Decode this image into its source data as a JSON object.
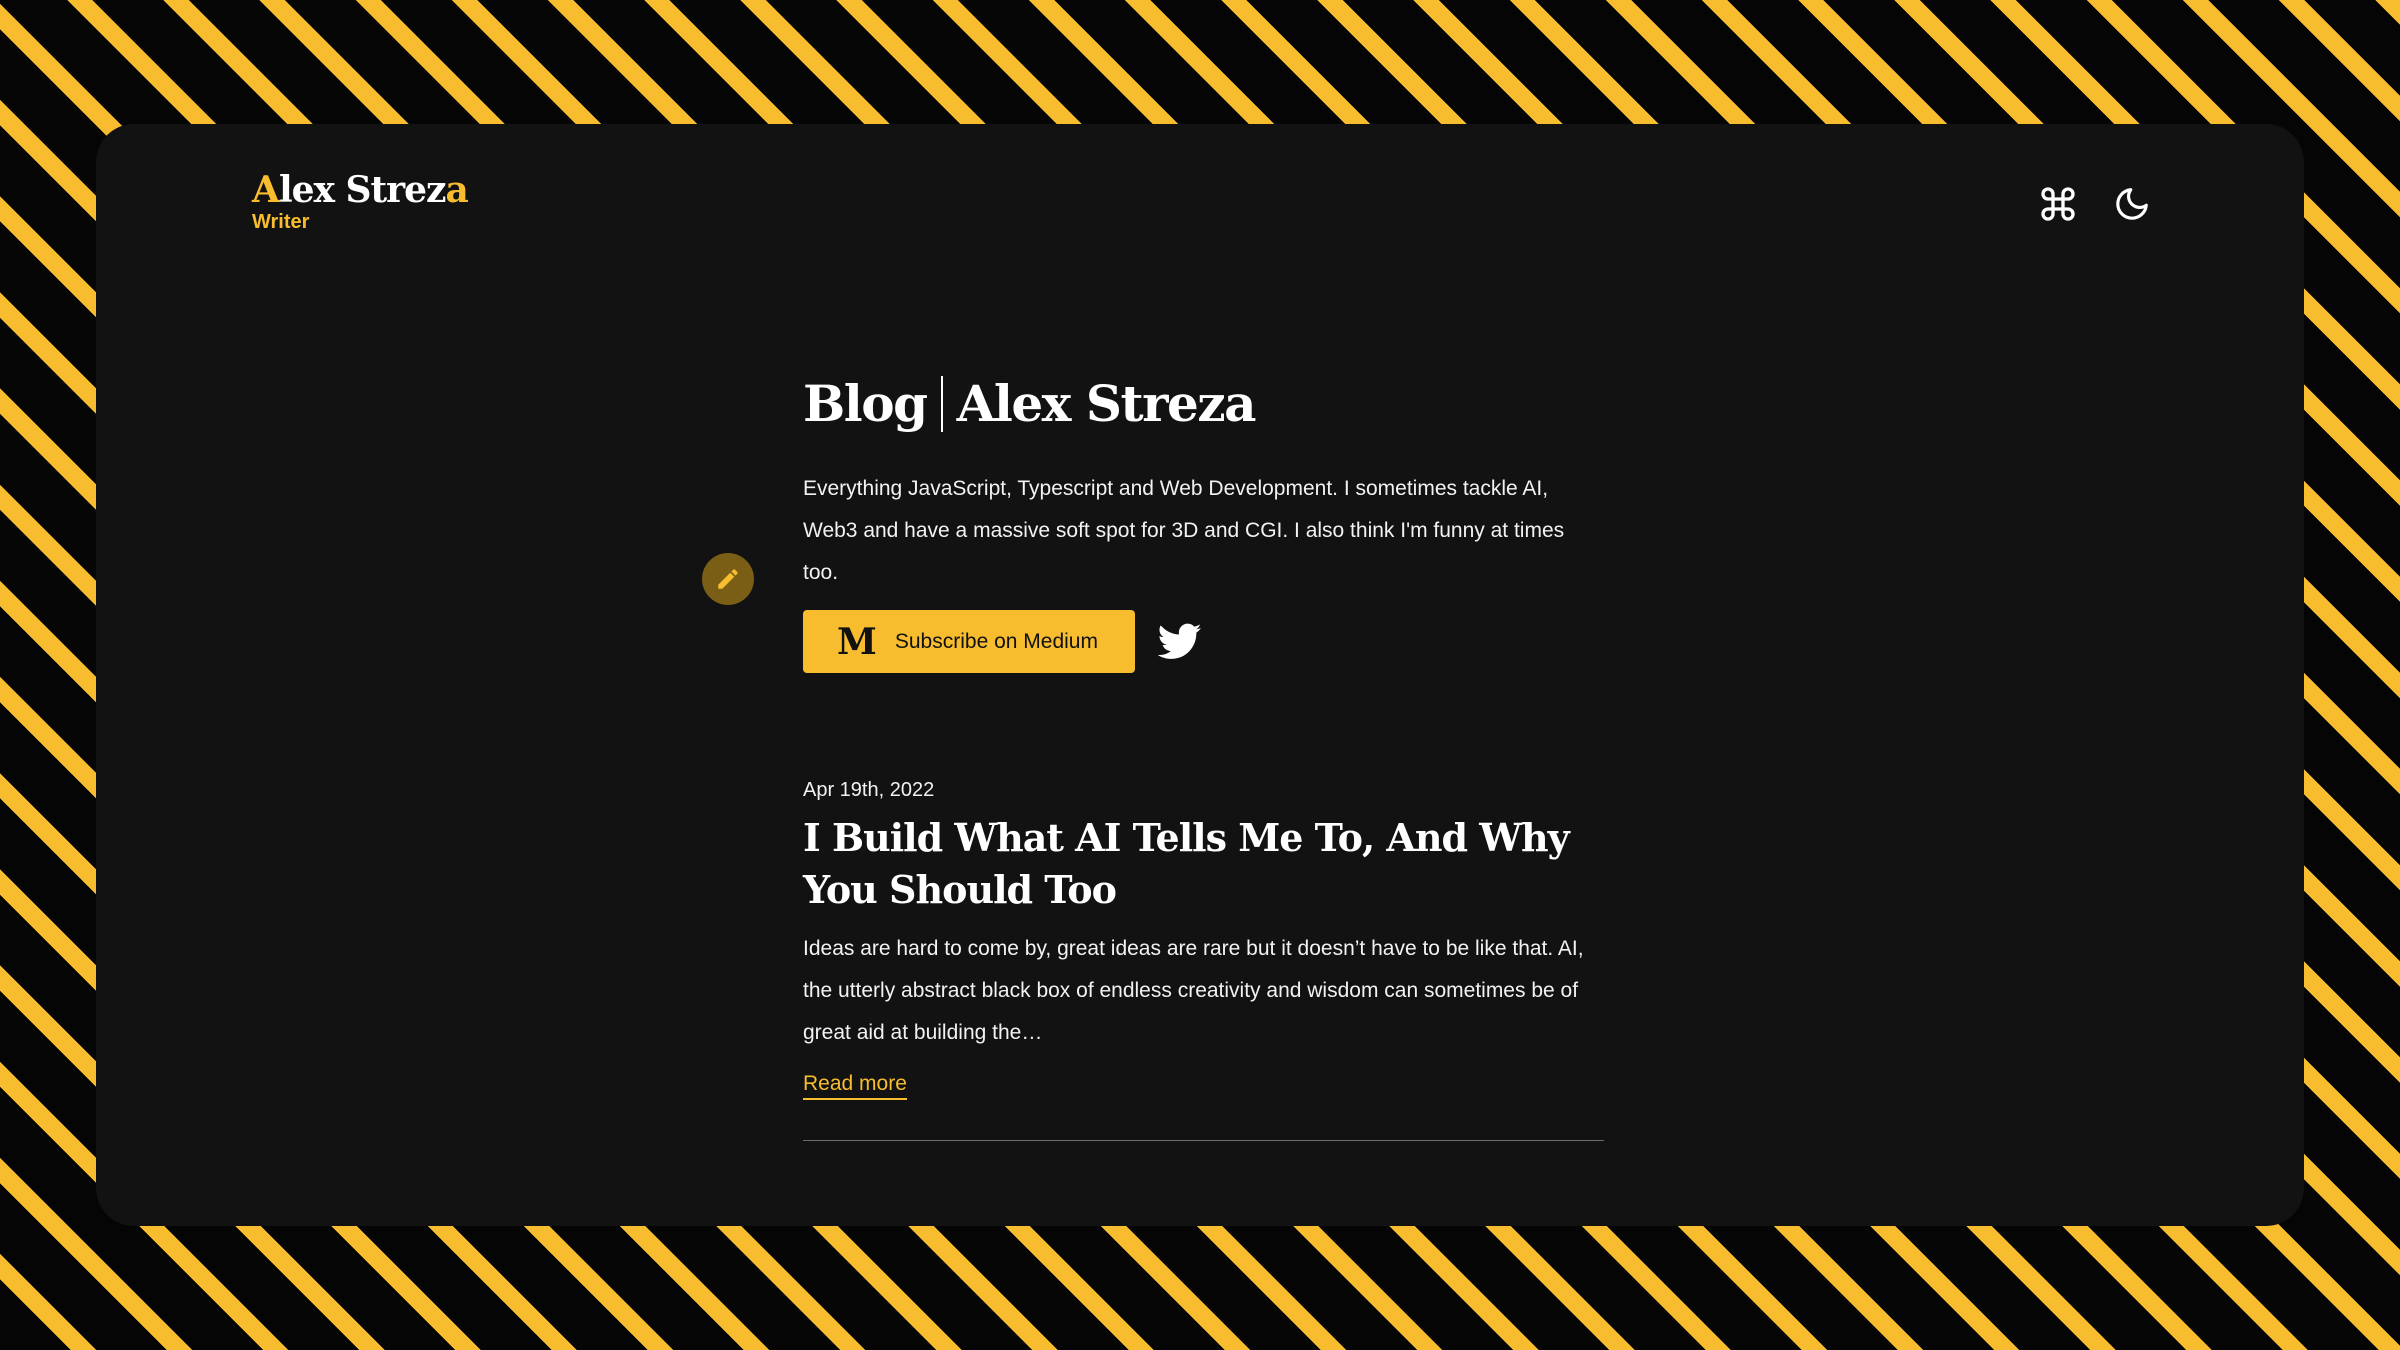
{
  "brand": {
    "name_main": "Alex Strez",
    "name_first_letter": "A",
    "name_middle": "lex Strez",
    "name_last_letter": "a",
    "subtitle": "Writer",
    "accent_color": "#f7bd2f"
  },
  "header": {
    "icons": [
      {
        "name": "command-icon"
      },
      {
        "name": "moon-icon"
      }
    ]
  },
  "blog": {
    "title_part1": "Blog",
    "title_part2": "Alex Streza",
    "description": "Everything JavaScript, Typescript and Web Development. I sometimes tackle AI, Web3 and have a massive soft spot for 3D and CGI. I also think I'm funny at times too.",
    "subscribe_label": "Subscribe on Medium",
    "medium_logo": "M"
  },
  "posts": [
    {
      "date": "Apr 19th, 2022",
      "title": "I Build What AI Tells Me To, And Why You Should Too",
      "excerpt": "Ideas are hard to come by, great ideas are rare but it doesn’t have to be like that. AI, the utterly abstract black box of endless creativity and wisdom can sometimes be of great aid at building the…",
      "read_more": "Read more"
    }
  ]
}
